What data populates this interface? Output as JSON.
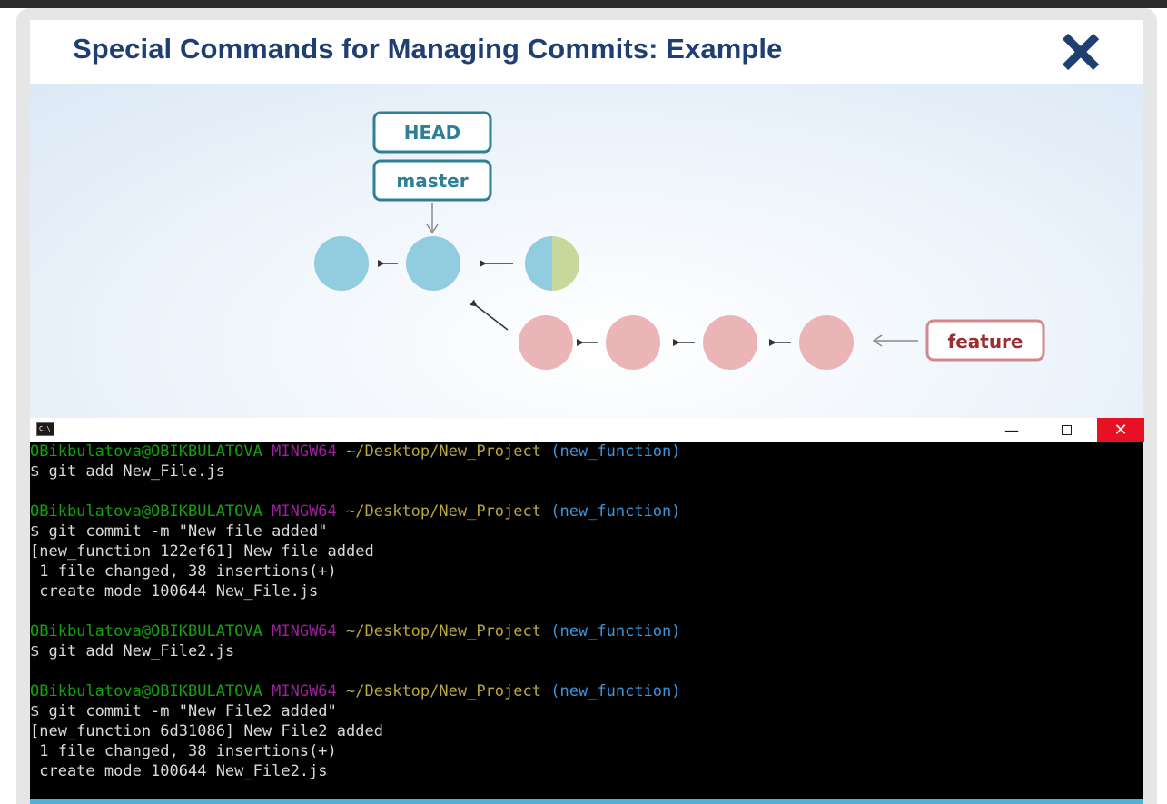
{
  "dialog": {
    "title": "Special Commands for Managing Commits: Example",
    "close_icon": "close-x-icon",
    "accent_color": "#1f3f73"
  },
  "diagram": {
    "labels": {
      "head": "HEAD",
      "master": "master",
      "feature": "feature"
    },
    "colors": {
      "master_commit": "#92cce0",
      "merge_commit_secondary": "#c6d99a",
      "feature_commit": "#ebb5b8",
      "head_label_border": "#2f7f96",
      "feature_label_border": "#d4878b",
      "feature_label_text": "#9b2e30"
    },
    "master_commit_count": 2,
    "merge_commit_count": 1,
    "feature_commit_count": 4
  },
  "terminal": {
    "icon": "console-icon",
    "window_buttons": {
      "minimize": "—",
      "maximize": "☐",
      "close": "✕"
    },
    "lines": [
      {
        "prompt": {
          "user": "OBikbulatova@OBIKBULATOVA",
          "env": "MINGW64",
          "path": "~/Desktop/New_Project",
          "branch": "(new_function)"
        }
      },
      {
        "text": "$ git add New_File.js"
      },
      {
        "text": ""
      },
      {
        "prompt": {
          "user": "OBikbulatova@OBIKBULATOVA",
          "env": "MINGW64",
          "path": "~/Desktop/New_Project",
          "branch": "(new_function)"
        }
      },
      {
        "text": "$ git commit -m \"New file added\""
      },
      {
        "text": "[new_function 122ef61] New file added"
      },
      {
        "text": " 1 file changed, 38 insertions(+)"
      },
      {
        "text": " create mode 100644 New_File.js"
      },
      {
        "text": ""
      },
      {
        "prompt": {
          "user": "OBikbulatova@OBIKBULATOVA",
          "env": "MINGW64",
          "path": "~/Desktop/New_Project",
          "branch": "(new_function)"
        }
      },
      {
        "text": "$ git add New_File2.js"
      },
      {
        "text": ""
      },
      {
        "prompt": {
          "user": "OBikbulatova@OBIKBULATOVA",
          "env": "MINGW64",
          "path": "~/Desktop/New_Project",
          "branch": "(new_function)"
        }
      },
      {
        "text": "$ git commit -m \"New File2 added\""
      },
      {
        "text": "[new_function 6d31086] New File2 added"
      },
      {
        "text": " 1 file changed, 38 insertions(+)"
      },
      {
        "text": " create mode 100644 New_File2.js"
      }
    ],
    "colors": {
      "user": "#13a10e",
      "env": "#a01ea0",
      "path": "#b7a73a",
      "branch": "#3a96dd"
    }
  }
}
